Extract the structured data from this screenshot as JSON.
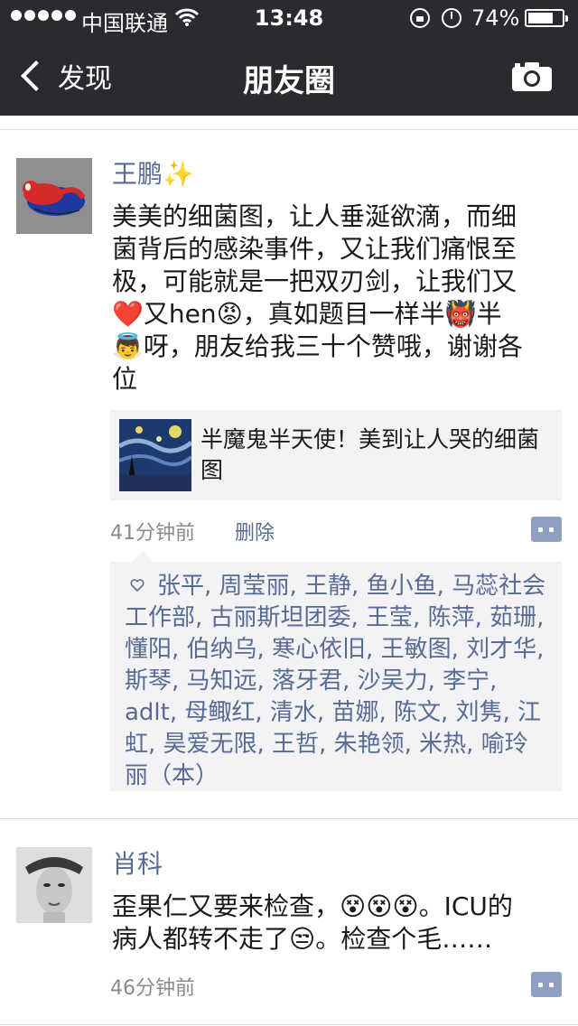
{
  "status_bar": {
    "carrier": "中国联通",
    "time": "13:48",
    "battery_text": "74%",
    "battery_level": 0.74
  },
  "nav": {
    "back_label": "发现",
    "title": "朋友圈"
  },
  "posts": [
    {
      "name": "王鹏✨",
      "text_lines": [
        "美美的细菌图，让人垂涎欲滴，而细",
        "菌背后的感染事件，又让我们痛恨至",
        "极，可能就是一把双刃剑，让我们又",
        "❤️又hen😡，真如题目一样半👹半",
        "👼呀，朋友给我三十个赞哦，谢谢各",
        "位"
      ],
      "link": {
        "title": "半魔鬼半天使！美到让人哭的细菌图"
      },
      "time": "41分钟前",
      "delete_label": "删除",
      "likes": "张平, 周莹丽, 王静, 鱼小鱼, 马蕊社会工作部, 古丽斯坦团委, 王莹, 陈萍, 茹珊, 懂阳, 伯纳乌, 寒心依旧, 王敏图, 刘才华, 斯琴, 马知远, 落牙君, 沙吴力, 李宁, adlt, 母鲰红, 清水, 苗娜, 陈文, 刘隽, 江虹, 昊爱无限, 王哲, 朱艳领, 米热, 喻玲丽（本）"
    },
    {
      "name": "肖科",
      "text_lines": [
        "歪果仁又要来检查，😵😵😵。ICU的",
        "病人都转不走了😒。检查个毛……"
      ],
      "time": "46分钟前"
    }
  ],
  "colors": {
    "nav_bg": "#2b2b2f",
    "name_link": "#576b95",
    "panel_bg": "#f3f3f5"
  },
  "icons": [
    "back-chevron-icon",
    "camera-icon",
    "heart-icon",
    "comment-icon",
    "wifi-icon",
    "battery-icon"
  ]
}
